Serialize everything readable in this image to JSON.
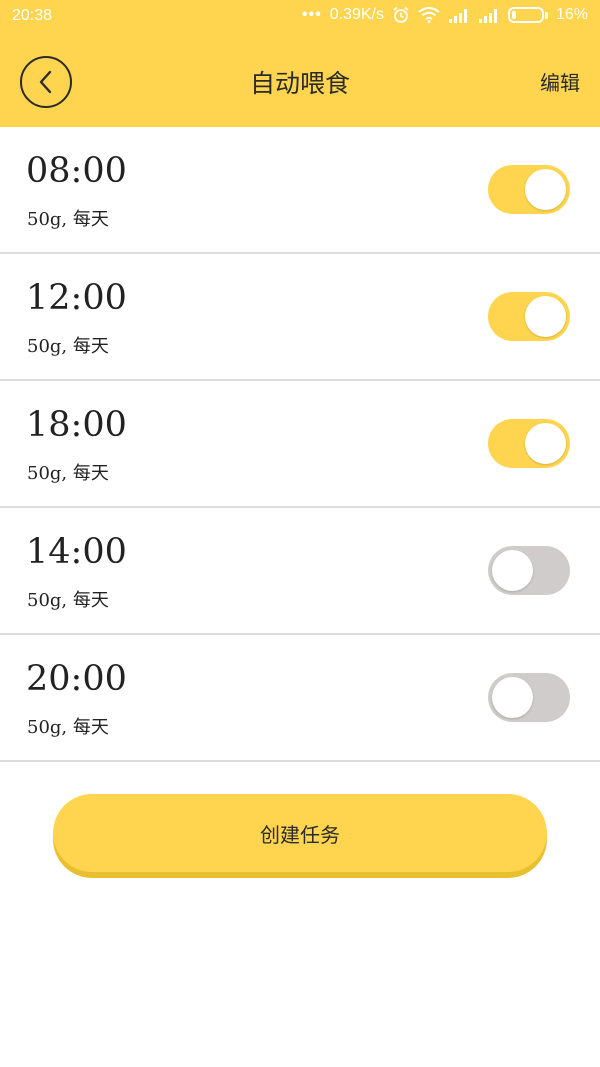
{
  "status_bar": {
    "time": "20:38",
    "network_speed": "0.39K/s",
    "battery_percent": "16%",
    "battery_level": 0.16,
    "icons": [
      "dots-icon",
      "alarm-icon",
      "wifi-icon",
      "signal-icon",
      "signal-icon",
      "battery-icon"
    ]
  },
  "header": {
    "title": "自动喂食",
    "edit_label": "编辑",
    "back_icon": "back-chevron-icon"
  },
  "feeding_tasks": [
    {
      "time": "08:00",
      "description": "50g, 每天",
      "enabled": true
    },
    {
      "time": "12:00",
      "description": "50g, 每天",
      "enabled": true
    },
    {
      "time": "18:00",
      "description": "50g, 每天",
      "enabled": true
    },
    {
      "time": "14:00",
      "description": "50g, 每天",
      "enabled": false
    },
    {
      "time": "20:00",
      "description": "50g, 每天",
      "enabled": false
    }
  ],
  "create_button_label": "创建任务",
  "colors": {
    "accent": "#ffd54f",
    "toggle_off": "#d0cccc",
    "divider": "#dcdcdc"
  }
}
